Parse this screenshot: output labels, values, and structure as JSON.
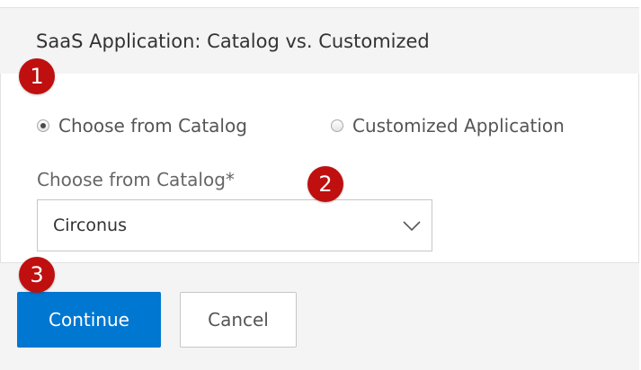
{
  "dialog": {
    "title": "SaaS Application: Catalog vs. Customized"
  },
  "steps": [
    "1",
    "2",
    "3"
  ],
  "radios": [
    {
      "label": "Choose from Catalog",
      "checked": true
    },
    {
      "label": "Customized Application",
      "checked": false
    }
  ],
  "catalog": {
    "label": "Choose from Catalog*",
    "selected": "Circonus"
  },
  "actions": {
    "continue_label": "Continue",
    "cancel_label": "Cancel"
  },
  "icons": {
    "dropdown": "chevron-down-icon",
    "radio_selected": "radio-selected-icon",
    "radio_unselected": "radio-unselected-icon"
  },
  "colors": {
    "primary": "#0077d0",
    "badge": "#c00f0f",
    "header_bg": "#f4f4f4",
    "text": "#333333"
  }
}
